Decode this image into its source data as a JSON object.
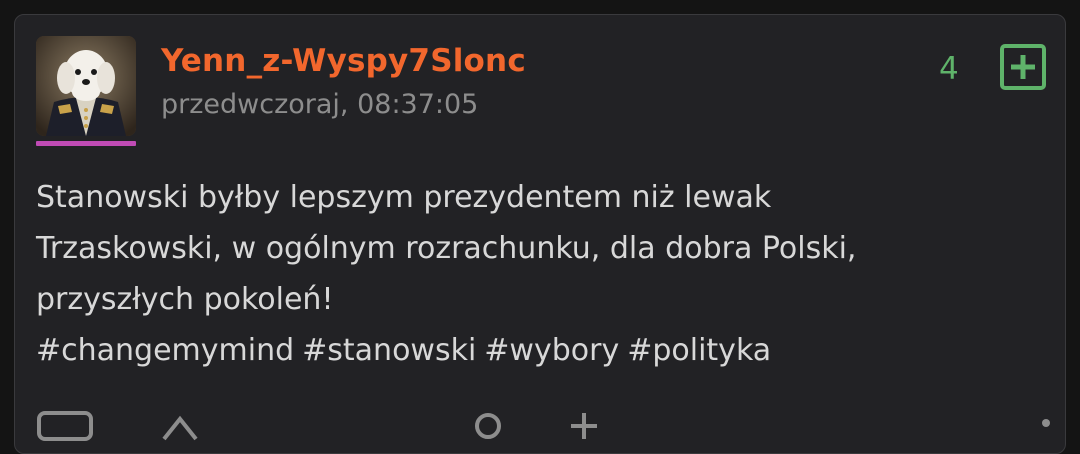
{
  "post": {
    "author": "Yenn_z-Wyspy7Slonc",
    "timestamp": "przedwczoraj, 08:37:05",
    "votes": "4",
    "avatar_icon": "maltese-dog-in-uniform-avatar",
    "plus_icon": "plus-square-icon",
    "body_lines": [
      "Stanowski byłby lepszym prezydentem niż lewak",
      "Trzaskowski, w ogólnym rozrachunku, dla dobra Polski,",
      "przyszłych pokoleń!"
    ],
    "tags": [
      "#changemymind",
      "#stanowski",
      "#wybory",
      "#polityka"
    ]
  },
  "colors": {
    "background": "#141414",
    "card": "#222225",
    "author": "#f2672d",
    "timestamp": "#8d8d8d",
    "vote_green": "#5fb36a",
    "text": "#d8d8d8",
    "avatar_underline": "#c04bb5"
  }
}
